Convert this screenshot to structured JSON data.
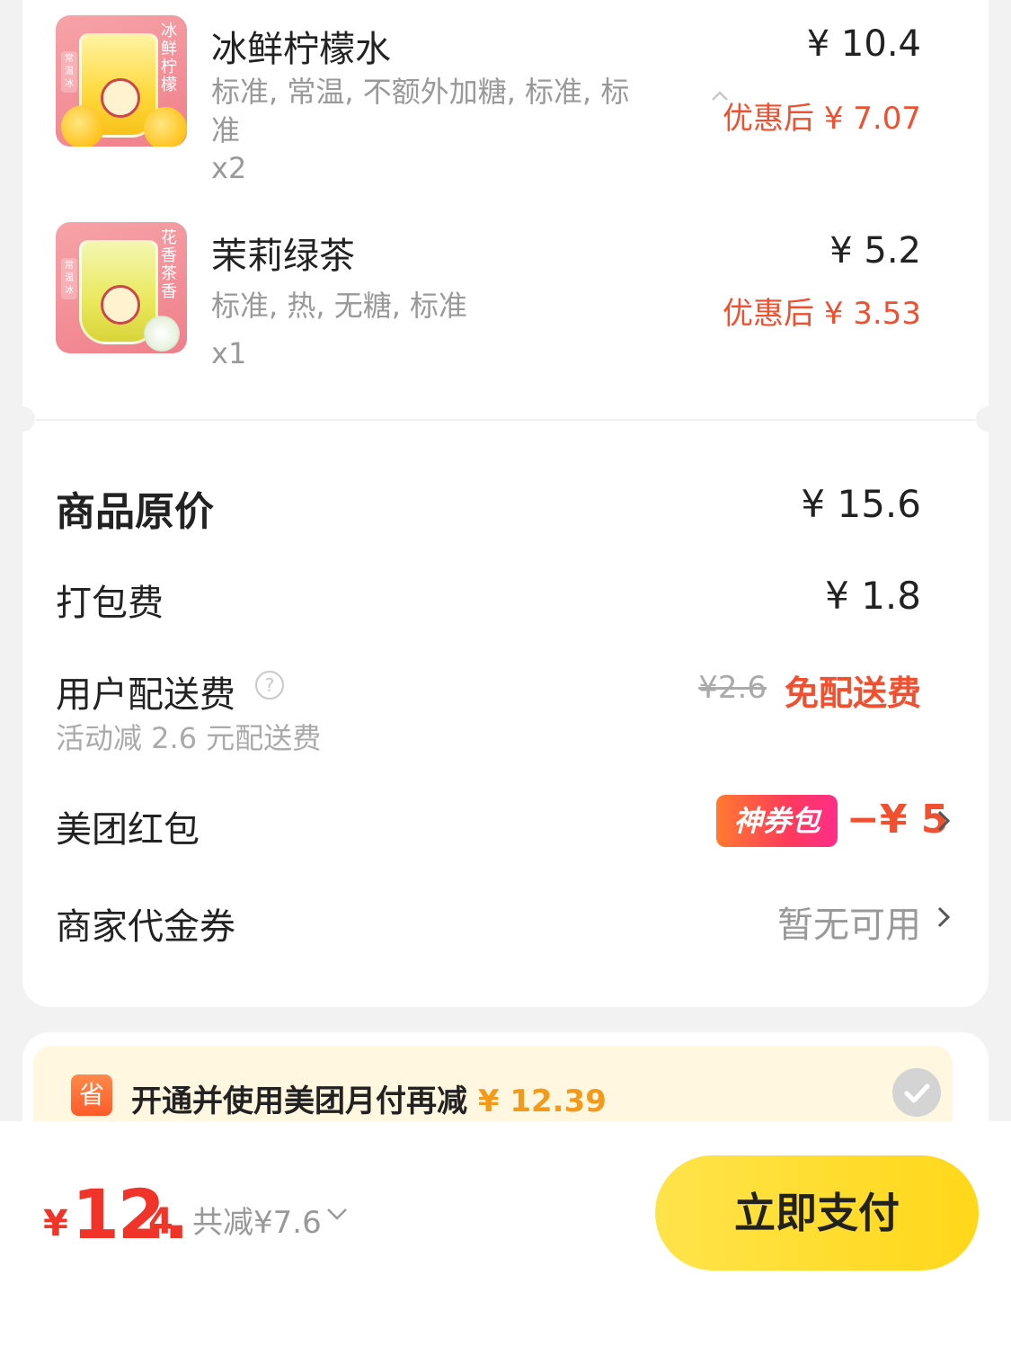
{
  "items": [
    {
      "name": "冰鲜柠檬水",
      "spec_line1": "标准, 常温, 不额外加糖, 标准, 标",
      "spec_line2": "准",
      "qty": "x2",
      "price": "¥ 10.4",
      "discounted": "优惠后 ¥ 7.07",
      "thumb_label": "冰鲜柠檬",
      "thumb_side": "常温冰"
    },
    {
      "name": "茉莉绿茶",
      "spec_line1": "标准, 热, 无糖, 标准",
      "qty": "x1",
      "price": "¥ 5.2",
      "discounted": "优惠后 ¥ 3.53",
      "thumb_label": "花香茶香",
      "thumb_side": "常温冰"
    }
  ],
  "fees": {
    "original_label": "商品原价",
    "original_value": "¥ 15.6",
    "packing_label": "打包费",
    "packing_value": "¥ 1.8",
    "delivery_label": "用户配送费",
    "delivery_help": "?",
    "delivery_note": "活动减 2.6 元配送费",
    "delivery_original": "¥2.6",
    "delivery_value": "免配送费",
    "redpacket_label": "美团红包",
    "redpacket_badge": "神券包",
    "redpacket_value": "−¥ 5",
    "voucher_label": "商家代金券",
    "voucher_value": "暂无可用"
  },
  "promo": {
    "icon_text": "省",
    "text": "开通并使用美团月付再减",
    "amount": "¥ 12.39"
  },
  "footer": {
    "currency": "¥",
    "total_int": "12.",
    "total_dec": "4",
    "saved": "共减¥7.6",
    "pay_button": "立即支付"
  },
  "colors": {
    "accent_red": "#f0502f",
    "pay_yellow": "#ffd81a",
    "promo_orange": "#f39a1a"
  }
}
